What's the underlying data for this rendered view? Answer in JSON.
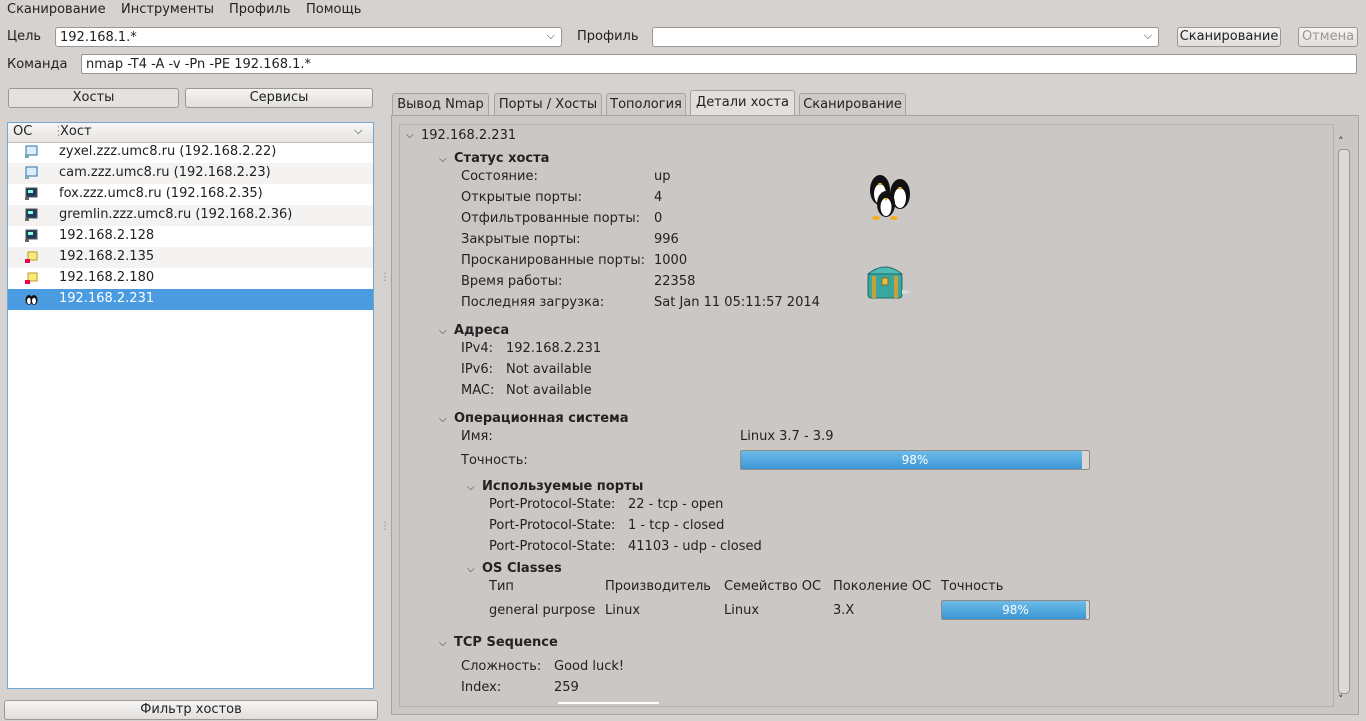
{
  "menu": [
    "Сканирование",
    "Инструменты",
    "Профиль",
    "Помощь"
  ],
  "toolbar": {
    "target_label": "Цель",
    "target_value": "192.168.1.*",
    "profile_label": "Профиль",
    "profile_value": "",
    "scan_button": "Сканирование",
    "cancel_button": "Отмена",
    "command_label": "Команда",
    "command_value": "nmap -T4 -A -v -Pn -PE 192.168.1.*"
  },
  "left": {
    "hosts_button": "Хосты",
    "services_button": "Сервисы",
    "col_os": "ОС",
    "col_host": "Хост",
    "hosts": [
      {
        "name": "zyxel.zzz.umc8.ru (192.168.2.22)",
        "icon": "monitor-icon"
      },
      {
        "name": "cam.zzz.umc8.ru (192.168.2.23)",
        "icon": "monitor-icon"
      },
      {
        "name": "fox.zzz.umc8.ru (192.168.2.35)",
        "icon": "computer-icon"
      },
      {
        "name": "gremlin.zzz.umc8.ru (192.168.2.36)",
        "icon": "computer-icon"
      },
      {
        "name": "192.168.2.128",
        "icon": "computer-icon"
      },
      {
        "name": "192.168.2.135",
        "icon": "unknown-os-icon"
      },
      {
        "name": "192.168.2.180",
        "icon": "unknown-os-icon"
      },
      {
        "name": "192.168.2.231",
        "icon": "linux-penguin-icon"
      }
    ],
    "selected_index": 7,
    "filter_button": "Фильтр хостов"
  },
  "tabs": [
    "Вывод Nmap",
    "Порты / Хосты",
    "Топология",
    "Детали хоста",
    "Сканирование"
  ],
  "active_tab": 3,
  "details": {
    "host_title": "192.168.2.231",
    "status": {
      "header": "Статус хоста",
      "rows": [
        {
          "k": "Состояние:",
          "v": "up"
        },
        {
          "k": "Открытые порты:",
          "v": "4"
        },
        {
          "k": "Отфильтрованные порты:",
          "v": "0"
        },
        {
          "k": "Закрытые порты:",
          "v": "996"
        },
        {
          "k": "Просканированные порты:",
          "v": "1000"
        },
        {
          "k": "Время работы:",
          "v": "22358"
        },
        {
          "k": "Последняя загрузка:",
          "v": "Sat Jan 11 05:11:57 2014"
        }
      ]
    },
    "addresses": {
      "header": "Адреса",
      "rows": [
        {
          "k": "IPv4:",
          "v": "192.168.2.231"
        },
        {
          "k": "IPv6:",
          "v": "Not available"
        },
        {
          "k": "MAC:",
          "v": "Not available"
        }
      ]
    },
    "os": {
      "header": "Операционная система",
      "name_label": "Имя:",
      "name_value": "Linux 3.7 - 3.9",
      "accuracy_label": "Точность:",
      "accuracy_text": "98%",
      "accuracy_fraction": 0.98,
      "ports_header": "Используемые порты",
      "ports": [
        {
          "k": "Port-Protocol-State:",
          "v": "22 - tcp - open"
        },
        {
          "k": "Port-Protocol-State:",
          "v": "1 - tcp - closed"
        },
        {
          "k": "Port-Protocol-State:",
          "v": "41103 - udp - closed"
        }
      ],
      "classes_header": "OS Classes",
      "classes_cols": [
        "Тип",
        "Производитель",
        "Семейство ОС",
        "Поколение ОС",
        "Точность"
      ],
      "classes_row": {
        "type": "general purpose",
        "vendor": "Linux",
        "family": "Linux",
        "gen": "3.X",
        "accuracy_text": "98%",
        "accuracy_fraction": 0.98
      }
    },
    "tcp": {
      "header": "TCP Sequence",
      "difficulty_label": "Сложность:",
      "difficulty_value": "Good luck!",
      "index_label": "Index:",
      "index_value": "259"
    }
  }
}
